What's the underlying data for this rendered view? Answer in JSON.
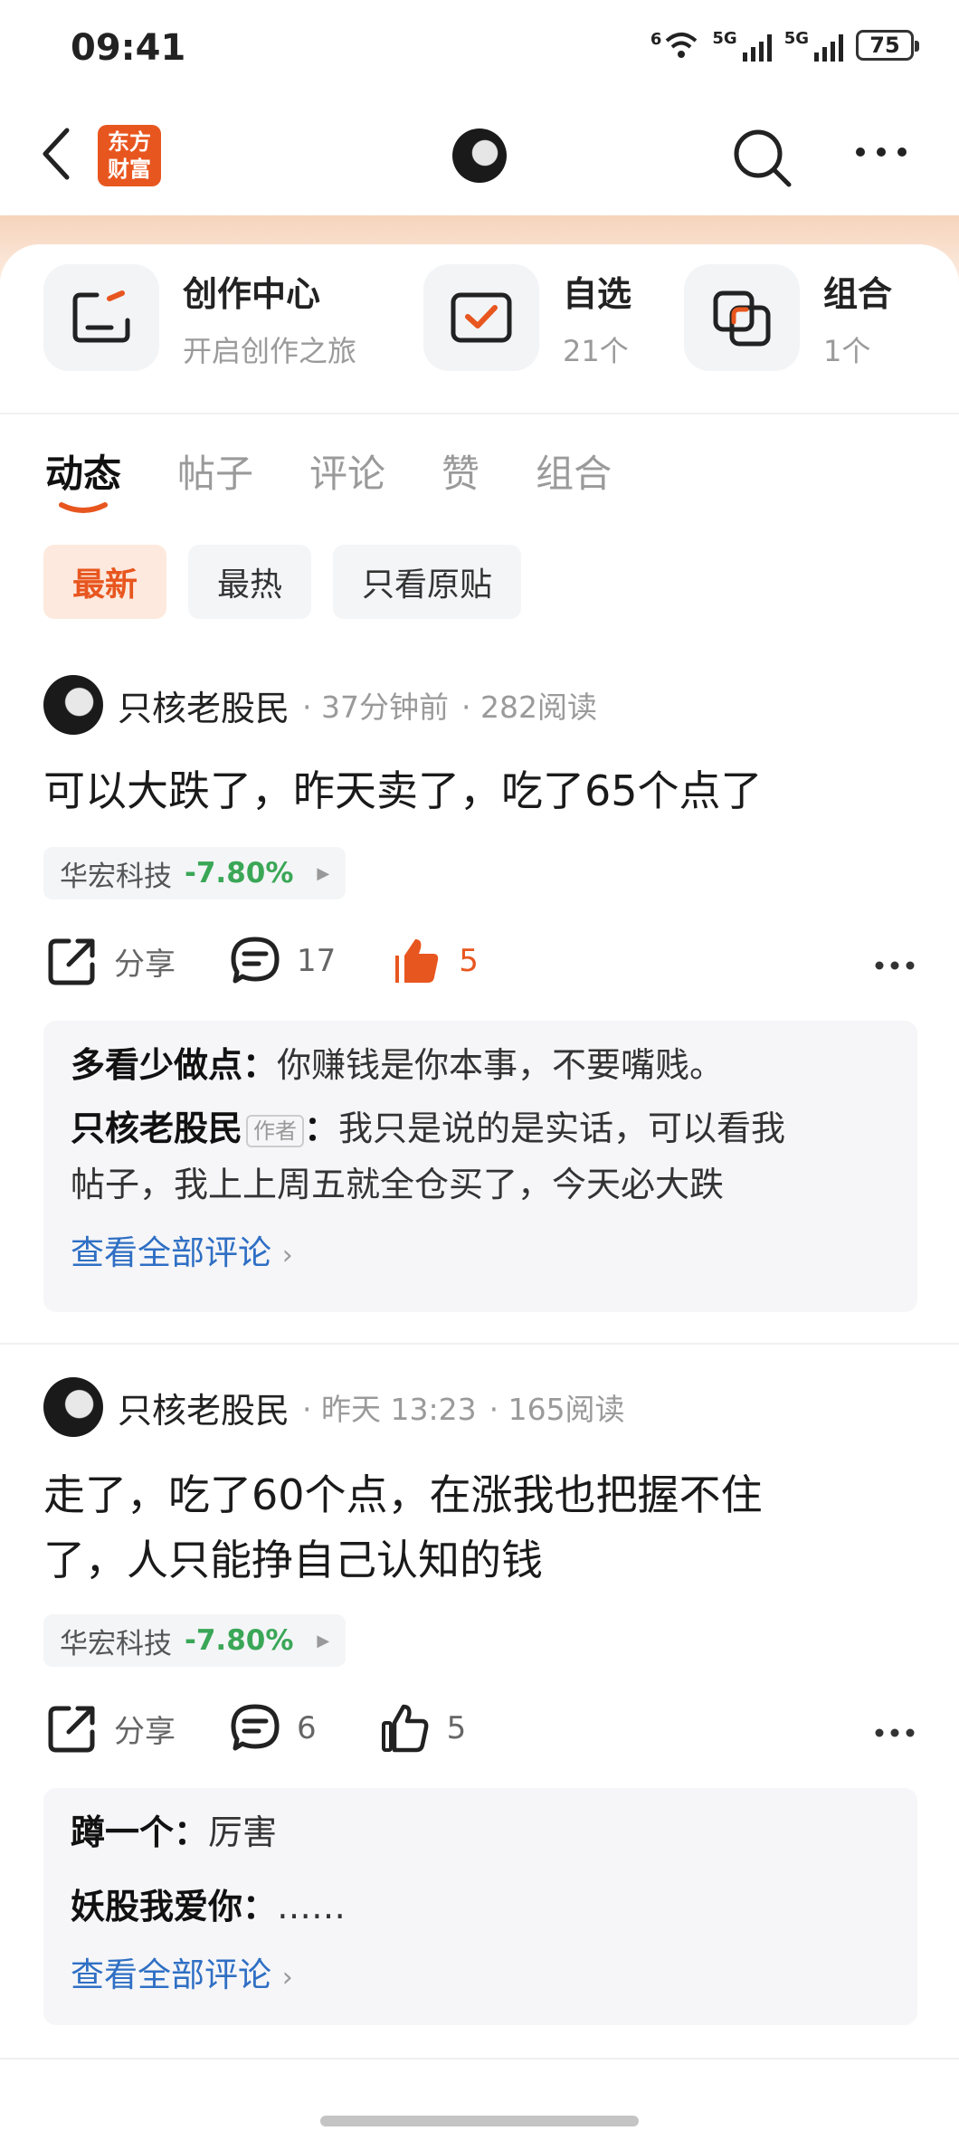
{
  "status_bar": {
    "time": "09:41",
    "net1": "6",
    "net2": "5G",
    "net3": "5G",
    "battery": "75"
  },
  "header": {
    "logo_line1": "东方",
    "logo_line2": "财富"
  },
  "quick_links": [
    {
      "title": "创作中心",
      "subtitle": "开启创作之旅"
    },
    {
      "title": "自选",
      "subtitle": "21个"
    },
    {
      "title": "组合",
      "subtitle": "1个"
    }
  ],
  "tabs": [
    "动态",
    "帖子",
    "评论",
    "赞",
    "组合"
  ],
  "filters": [
    "最新",
    "最热",
    "只看原贴"
  ],
  "posts": [
    {
      "user": "只核老股民",
      "time": "· 37分钟前",
      "reads": "· 282阅读",
      "text": "可以大跌了，昨天卖了，吃了65个点了",
      "stock_name": "华宏科技",
      "stock_change": "-7.80%",
      "share_label": "分享",
      "comment_count": "17",
      "like_count": "5",
      "liked": true,
      "comments": [
        {
          "author": "多看少做点",
          "sep": "：",
          "text": "你赚钱是你本事，不要嘴贱。",
          "is_author": false
        },
        {
          "author": "只核老股民",
          "badge": "作者",
          "sep": "：",
          "text": "我只是说的是实话，可以看我",
          "text2": "帖子，我上上周五就全仓买了，今天必大跌",
          "is_author": true
        }
      ],
      "view_all": "查看全部评论"
    },
    {
      "user": "只核老股民",
      "time": "· 昨天 13:23",
      "reads": "· 165阅读",
      "text_line1": "走了，吃了60个点，在涨我也把握不住",
      "text_line2": "了，人只能挣自己认知的钱",
      "stock_name": "华宏科技",
      "stock_change": "-7.80%",
      "share_label": "分享",
      "comment_count": "6",
      "like_count": "5",
      "liked": false,
      "comments": [
        {
          "author": "蹲一个",
          "sep": "：",
          "text": "厉害"
        },
        {
          "author": "妖股我爱你",
          "sep": "：",
          "text": "……"
        }
      ],
      "view_all": "查看全部评论"
    }
  ],
  "colors": {
    "accent": "#e8561f",
    "down_green": "#3aa757",
    "link_blue": "#2f6fc4"
  }
}
